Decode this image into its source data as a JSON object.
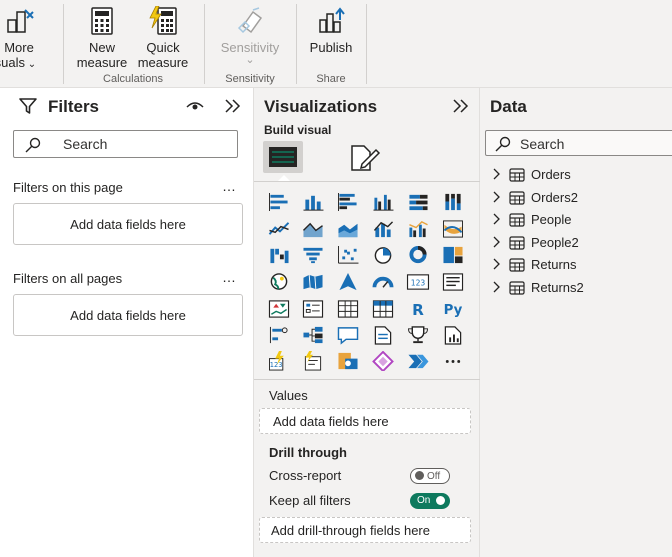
{
  "ribbon": {
    "more_visuals": {
      "line1": "More",
      "line2": "isuals",
      "chevron": "chevron-down-icon"
    },
    "new_measure": {
      "line1": "New",
      "line2": "measure"
    },
    "quick_measure": {
      "line1": "Quick",
      "line2": "measure"
    },
    "sensitivity": {
      "label": "Sensitivity",
      "sub": "⌄"
    },
    "publish": {
      "label": "Publish"
    },
    "groups": {
      "calculations": "Calculations",
      "sensitivity": "Sensitivity",
      "share": "Share"
    }
  },
  "filters": {
    "title": "Filters",
    "search_placeholder": "Search",
    "on_this_page": {
      "label": "Filters on this page",
      "drop": "Add data fields here",
      "more": "…"
    },
    "on_all_pages": {
      "label": "Filters on all pages",
      "drop": "Add data fields here",
      "more": "…"
    }
  },
  "visualizations": {
    "title": "Visualizations",
    "build_visual": "Build visual",
    "values_label": "Values",
    "values_drop": "Add data fields here",
    "drill_through": "Drill through",
    "cross_report": {
      "label": "Cross-report",
      "state": "Off"
    },
    "keep_all_filters": {
      "label": "Keep all filters",
      "state": "On"
    },
    "drill_drop": "Add drill-through fields here",
    "more": "···",
    "r_label": "R",
    "py_label": "Py"
  },
  "data": {
    "title": "Data",
    "search_placeholder": "Search",
    "tables": [
      "Orders",
      "Orders2",
      "People",
      "People2",
      "Returns",
      "Returns2"
    ]
  },
  "colors": {
    "accent_green": "#0e7a5e",
    "icon_blue": "#1a6fb5",
    "icon_yellow": "#f2c811"
  }
}
